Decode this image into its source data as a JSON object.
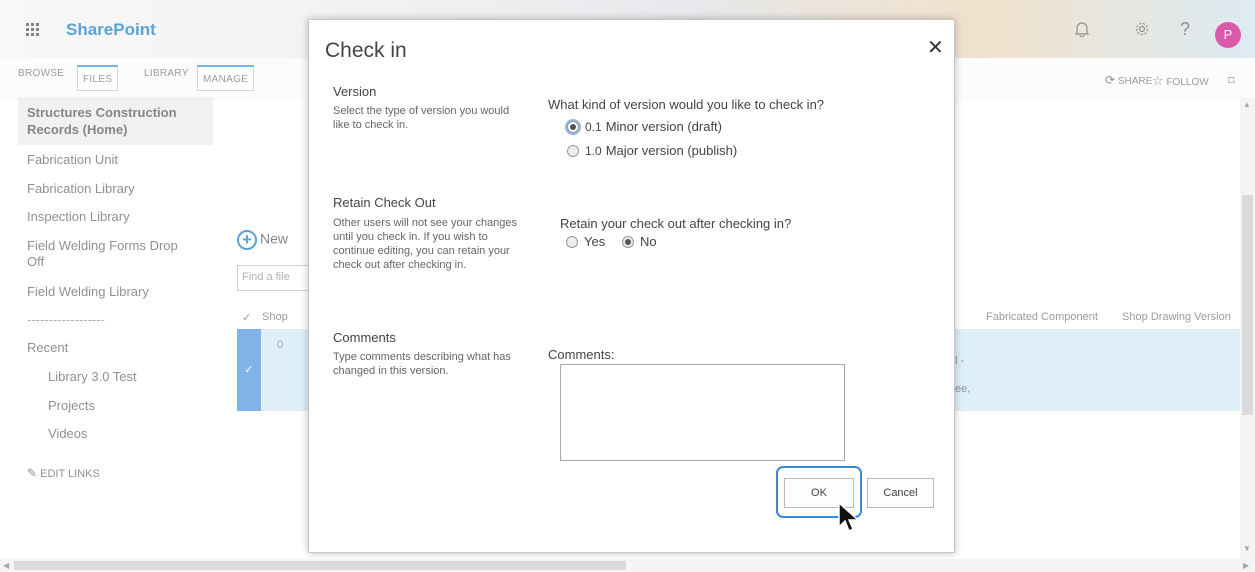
{
  "suite": {
    "app_name": "SharePoint",
    "avatar_initial": "P"
  },
  "ribbon": {
    "tabs": [
      "BROWSE",
      "FILES",
      "LIBRARY",
      "MANAGE"
    ],
    "share": "SHARE",
    "follow": "FOLLOW"
  },
  "nav": {
    "home": "Structures Construction Records (Home)",
    "items": [
      "Fabrication Unit",
      "Fabrication Library",
      "Inspection Library",
      "Field Welding Forms Drop Off",
      "Field Welding Library",
      "------------------",
      "Recent"
    ],
    "recent": [
      "Library 3.0 Test",
      "Projects",
      "Videos"
    ],
    "edit_links": "EDIT LINKS"
  },
  "main": {
    "new_label": "New",
    "find_placeholder": "Find a file",
    "col_check": "✓",
    "col_shop": "Shop",
    "col_fabricated": "Fabricated Component",
    "col_drawing": "Shop Drawing Version",
    "row_value": "0",
    "row_frag1": "l -",
    "row_frag2": "ee,"
  },
  "dialog": {
    "title": "Check in",
    "version": {
      "heading": "Version",
      "description": "Select the type of version you would like to check in.",
      "question": "What kind of version would you like to check in?",
      "options": [
        {
          "num": "0.1",
          "label": "Minor version (draft)",
          "selected": true
        },
        {
          "num": "1.0",
          "label": "Major version (publish)",
          "selected": false
        }
      ]
    },
    "retain": {
      "heading": "Retain Check Out",
      "description": "Other users will not see your changes until you check in. If you wish to continue editing, you can retain your check out after checking in.",
      "question": "Retain your check out after checking in?",
      "yes": "Yes",
      "no": "No",
      "selected": "No"
    },
    "comments": {
      "heading": "Comments",
      "description": "Type comments describing what has changed in this version.",
      "label": "Comments:",
      "value": ""
    },
    "ok": "OK",
    "cancel": "Cancel"
  },
  "colors": {
    "brand": "#0072c6",
    "accent": "#3a87d8",
    "avatar": "#c6007d",
    "selected_row": "#cde6f7"
  }
}
